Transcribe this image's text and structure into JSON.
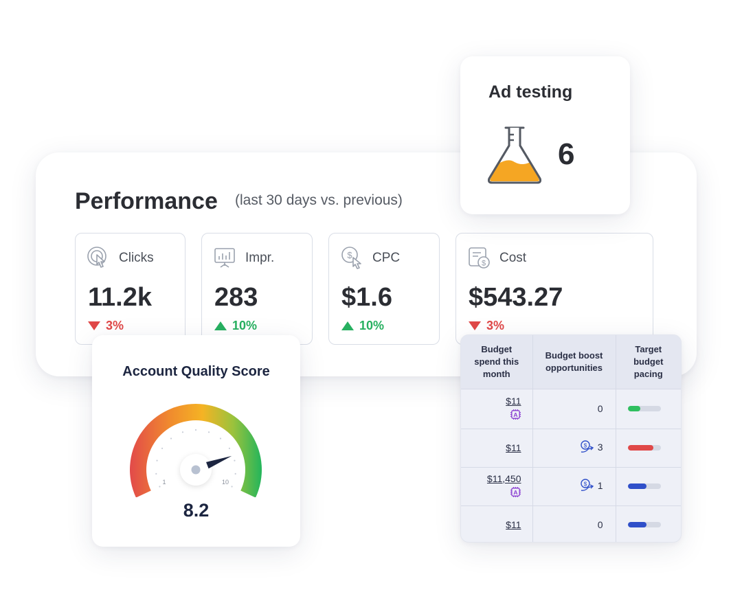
{
  "performance": {
    "title": "Performance",
    "subtitle": "(last 30 days vs. previous)",
    "metrics": [
      {
        "label": "Clicks",
        "value": "11.2k",
        "change": "3%",
        "direction": "down",
        "icon": "cursor-click-icon"
      },
      {
        "label": "Impr.",
        "value": "283",
        "change": "10%",
        "direction": "up",
        "icon": "presentation-chart-icon"
      },
      {
        "label": "CPC",
        "value": "$1.6",
        "change": "10%",
        "direction": "up",
        "icon": "dollar-click-icon"
      },
      {
        "label": "Cost",
        "value": "$543.27",
        "change": "3%",
        "direction": "down",
        "icon": "invoice-dollar-icon"
      }
    ],
    "colors": {
      "down": "#e04848",
      "up": "#27b060"
    }
  },
  "ad_testing": {
    "title": "Ad testing",
    "count": "6",
    "icon": "flask-icon",
    "flask_color": "#f5a623"
  },
  "quality_score": {
    "title": "Account Quality Score",
    "value": "8.2",
    "score": 8.2,
    "scale_min": "1",
    "scale_max": "10"
  },
  "budget_table": {
    "headers": [
      "Budget spend this month",
      "Budget boost opportunities",
      "Target budget pacing"
    ],
    "rows": [
      {
        "spend": "$11",
        "ai": true,
        "boost": "0",
        "boost_icon": false,
        "pacing": 0.38,
        "pacing_color": "#2fbf5f"
      },
      {
        "spend": "$11",
        "ai": false,
        "boost": "3",
        "boost_icon": true,
        "pacing": 0.78,
        "pacing_color": "#e04848"
      },
      {
        "spend": "$11,450",
        "ai": true,
        "boost": "1",
        "boost_icon": true,
        "pacing": 0.58,
        "pacing_color": "#2f4fc9"
      },
      {
        "spend": "$11",
        "ai": false,
        "boost": "0",
        "boost_icon": false,
        "pacing": 0.58,
        "pacing_color": "#2f4fc9"
      }
    ]
  }
}
